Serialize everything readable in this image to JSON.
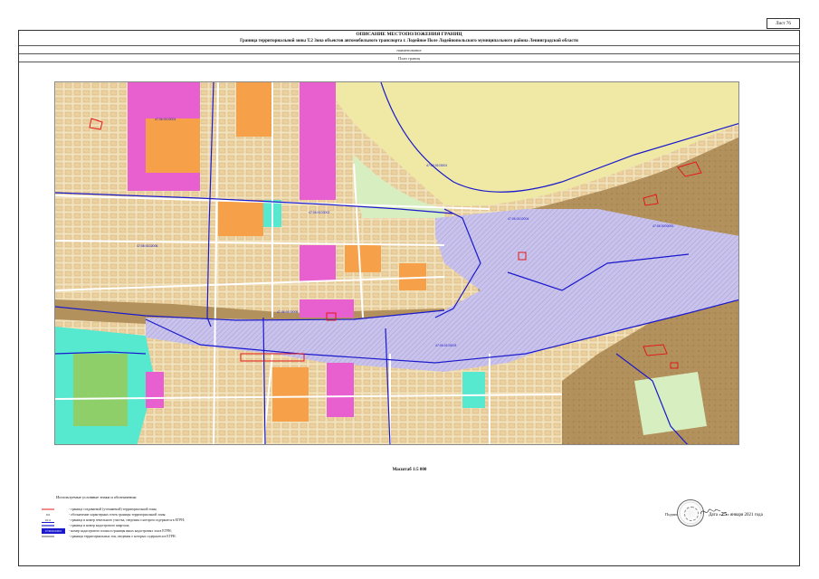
{
  "sheet_tag": "Лист 76",
  "header": {
    "title": "ОПИСАНИЕ МЕСТОПОЛОЖЕНИЯ ГРАНИЦ",
    "subtitle": "Граница территориальной зоны  Т.2 Зона объектов автомобильного транспорта  г. Лодейное Поле Лодейнопольского муниципального района Ленинградской области",
    "row2": "наименование",
    "row3": "План границ"
  },
  "map": {
    "colors": {
      "residential": "#f3e1b9",
      "brown": "#b3915c",
      "orange": "#f7a04a",
      "magenta": "#e85fcf",
      "lilac": "#c9c2ea",
      "cyan": "#57e8d0",
      "river": "#efe9a5",
      "pale_green": "#d7efc0",
      "green": "#8fcf6a",
      "boundary": "#1a1acc",
      "zone_outline": "#e21a1a"
    },
    "zone_labels": [
      "47:06:0102001",
      "47:06:0103002",
      "47:06:0102006",
      "47:06:0102005",
      "47:06:0103001",
      "47:06:0102004",
      "47:06:0000000",
      "47:06:0103003"
    ]
  },
  "scale": "Масштаб 1:5 000",
  "legend": {
    "title": "Используемые условные знаки и обозначения:",
    "items": [
      {
        "symbol": "red-line",
        "text": "- граница создаваемой (уточняемой) территориальной зоны;"
      },
      {
        "symbol": "point-label",
        "sample": "0.0",
        "text": "- обозначение характерных точек границы территориальной зоны;"
      },
      {
        "symbol": "parcel-label",
        "sample": "1011",
        "text": "- граница и номер земельного участка, сведения о котором содержатся в ЕГРН;"
      },
      {
        "symbol": "blue-line",
        "text": "- граница и номер кадастрового квартала;"
      },
      {
        "symbol": "block-label",
        "sample": "47:06:0102001",
        "text": "- номер кадастрового плана и границы иных кадастровых зон в ЕГРН;"
      },
      {
        "symbol": "dark-line",
        "text": "- границы территориальных зон, сведения о которых содержатся в ЕГРН."
      }
    ]
  },
  "sign": {
    "label": "Подпись",
    "date_prefix": "Дата «",
    "date_day": "25",
    "date_suffix": "» января   2021 года"
  }
}
